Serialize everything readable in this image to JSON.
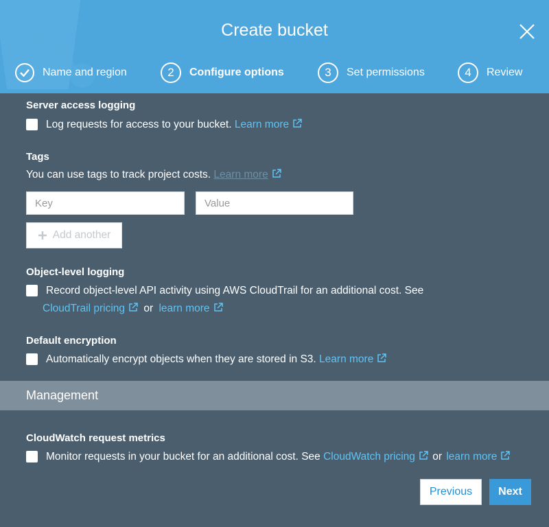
{
  "dialog": {
    "title": "Create bucket"
  },
  "steps": [
    {
      "number": "",
      "label": "Name and region",
      "state": "complete"
    },
    {
      "number": "2",
      "label": "Configure options",
      "state": "active"
    },
    {
      "number": "3",
      "label": "Set permissions",
      "state": "pending"
    },
    {
      "number": "4",
      "label": "Review",
      "state": "pending"
    }
  ],
  "server_access_logging": {
    "title": "Server access logging",
    "checkbox_label": "Log requests for access to your bucket.",
    "checked": false,
    "link": "Learn more"
  },
  "tags": {
    "title": "Tags",
    "description": "You can use tags to track project costs.",
    "link": "Learn more",
    "key_placeholder": "Key",
    "value_placeholder": "Value",
    "add_button": "Add another"
  },
  "object_level_logging": {
    "title": "Object-level logging",
    "checkbox_label": "Record object-level API activity using AWS CloudTrail for an additional cost. See",
    "checked": false,
    "link1": "CloudTrail pricing",
    "connector": "or",
    "link2": "learn more"
  },
  "default_encryption": {
    "title": "Default encryption",
    "checkbox_label": "Automatically encrypt objects when they are stored in S3.",
    "checked": false,
    "link": "Learn more"
  },
  "management": {
    "title": "Management"
  },
  "cloudwatch": {
    "title": "CloudWatch request metrics",
    "checkbox_label": "Monitor requests in your bucket for an additional cost. See",
    "checked": false,
    "link1": "CloudWatch pricing",
    "connector": "or",
    "link2": "learn more"
  },
  "footer": {
    "previous": "Previous",
    "next": "Next"
  },
  "colors": {
    "header_bg": "#4da6dc",
    "body_bg": "#4a5e6e",
    "link": "#5ec4f5",
    "primary_button": "#3a9ad9"
  },
  "icons": [
    "check-icon",
    "close-icon",
    "external-link-icon",
    "plus-icon"
  ]
}
